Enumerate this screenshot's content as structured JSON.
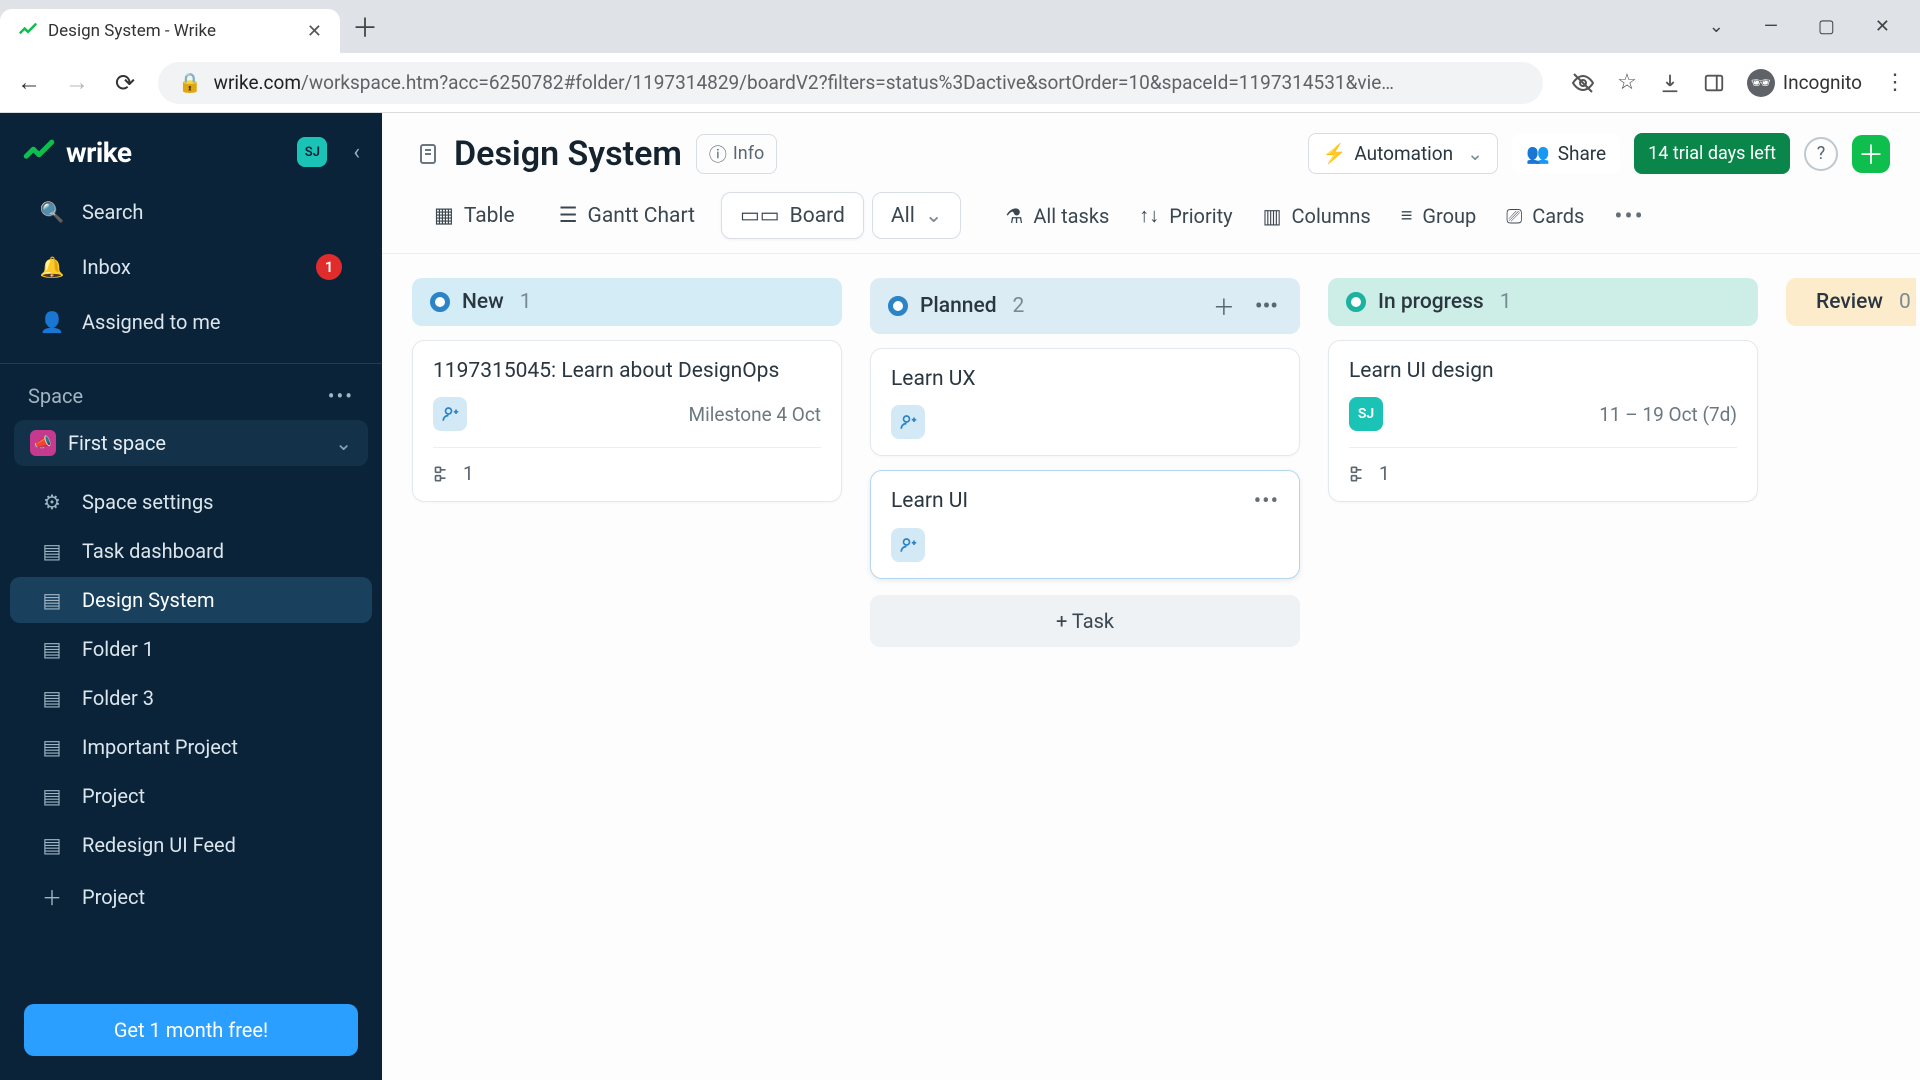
{
  "browser": {
    "tab_title": "Design System - Wrike",
    "url_host": "wrike.com",
    "url_path": "/workspace.htm?acc=6250782#folder/1197314829/boardV2?filters=status%3Dactive&sortOrder=10&spaceId=1197314531&vie…",
    "incognito_label": "Incognito"
  },
  "sidebar": {
    "logo_text": "wrike",
    "user_initials": "SJ",
    "search": "Search",
    "inbox": "Inbox",
    "inbox_badge": "1",
    "assigned": "Assigned to me",
    "space_heading": "Space",
    "first_space": "First space",
    "tree": [
      {
        "icon": "gear",
        "label": "Space settings"
      },
      {
        "icon": "doc",
        "label": "Task dashboard"
      },
      {
        "icon": "doc",
        "label": "Design System",
        "active": true
      },
      {
        "icon": "doc",
        "label": "Folder 1"
      },
      {
        "icon": "doc",
        "label": "Folder 3"
      },
      {
        "icon": "doc",
        "label": "Important Project"
      },
      {
        "icon": "doc",
        "label": "Project"
      },
      {
        "icon": "doc",
        "label": "Redesign UI Feed"
      },
      {
        "icon": "plus",
        "label": "Project"
      }
    ],
    "promo": "Get 1 month free!"
  },
  "header": {
    "title": "Design System",
    "info": "Info",
    "automation": "Automation",
    "share": "Share",
    "trial": "14 trial days left"
  },
  "toolbar": {
    "table": "Table",
    "gantt": "Gantt Chart",
    "board": "Board",
    "all": "All",
    "all_tasks": "All tasks",
    "priority": "Priority",
    "columns": "Columns",
    "group": "Group",
    "cards": "Cards"
  },
  "board": {
    "columns": [
      {
        "key": "new",
        "name": "New",
        "count": "1",
        "headClass": "ch-new",
        "cards": [
          {
            "title": "1197315045: Learn about DesignOps",
            "assignee": "add",
            "meta": "Milestone 4 Oct",
            "subtasks": "1"
          }
        ]
      },
      {
        "key": "planned",
        "name": "Planned",
        "count": "2",
        "headClass": "ch-plan",
        "show_controls": true,
        "cards": [
          {
            "title": "Learn UX",
            "assignee": "add"
          },
          {
            "title": "Learn UI",
            "assignee": "add",
            "hover": true,
            "show_menu": true
          }
        ],
        "add_task_label": "+ Task"
      },
      {
        "key": "inprogress",
        "name": "In progress",
        "count": "1",
        "headClass": "ch-prog",
        "cards": [
          {
            "title": "Learn UI design",
            "assignee": "SJ",
            "meta": "11 – 19 Oct (7d)",
            "subtasks": "1"
          }
        ]
      },
      {
        "key": "review",
        "name": "Review",
        "count": "0",
        "headClass": "ch-rev",
        "truncated": true
      }
    ]
  }
}
